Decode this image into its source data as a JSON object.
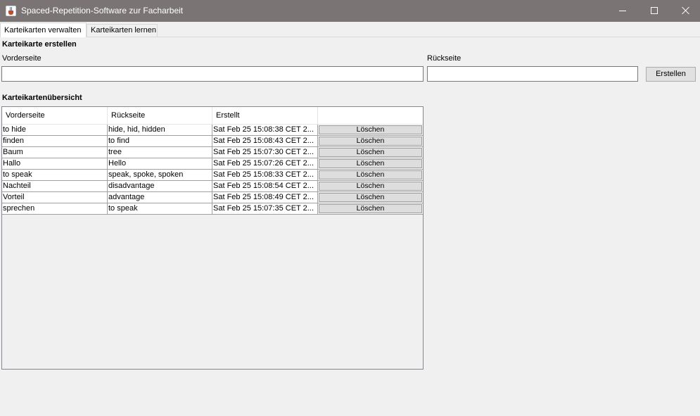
{
  "window": {
    "title": "Spaced-Repetition-Software zur Facharbeit",
    "titlebar_color": "#7a7574"
  },
  "tabs": [
    {
      "label": "Karteikarten verwalten",
      "active": true
    },
    {
      "label": "Karteikarten lernen",
      "active": false
    }
  ],
  "create": {
    "heading": "Karteikarte erstellen",
    "front_label": "Vorderseite",
    "back_label": "Rückseite",
    "front_value": "",
    "back_value": "",
    "button_label": "Erstellen"
  },
  "overview": {
    "heading": "Karteikartenübersicht",
    "columns": [
      "Vorderseite",
      "Rückseite",
      "Erstellt",
      ""
    ],
    "rows": [
      {
        "front": "to hide",
        "back": "hide, hid, hidden",
        "created": "Sat Feb 25 15:08:38 CET 2...",
        "action": "Löschen"
      },
      {
        "front": "finden",
        "back": "to find",
        "created": "Sat Feb 25 15:08:43 CET 2...",
        "action": "Löschen"
      },
      {
        "front": "Baum",
        "back": "tree",
        "created": "Sat Feb 25 15:07:30 CET 2...",
        "action": "Löschen"
      },
      {
        "front": "Hallo",
        "back": "Hello",
        "created": "Sat Feb 25 15:07:26 CET 2...",
        "action": "Löschen"
      },
      {
        "front": "to speak",
        "back": "speak, spoke, spoken",
        "created": "Sat Feb 25 15:08:33 CET 2...",
        "action": "Löschen"
      },
      {
        "front": "Nachteil",
        "back": "disadvantage",
        "created": "Sat Feb 25 15:08:54 CET 2...",
        "action": "Löschen"
      },
      {
        "front": "Vorteil",
        "back": "advantage",
        "created": "Sat Feb 25 15:08:49 CET 2...",
        "action": "Löschen"
      },
      {
        "front": "sprechen",
        "back": "to speak",
        "created": "Sat Feb 25 15:07:35 CET 2...",
        "action": "Löschen"
      }
    ]
  },
  "icons": {
    "app": "java-coffee-cup-icon",
    "minimize": "minimize-icon",
    "maximize": "maximize-icon",
    "close": "close-icon"
  }
}
